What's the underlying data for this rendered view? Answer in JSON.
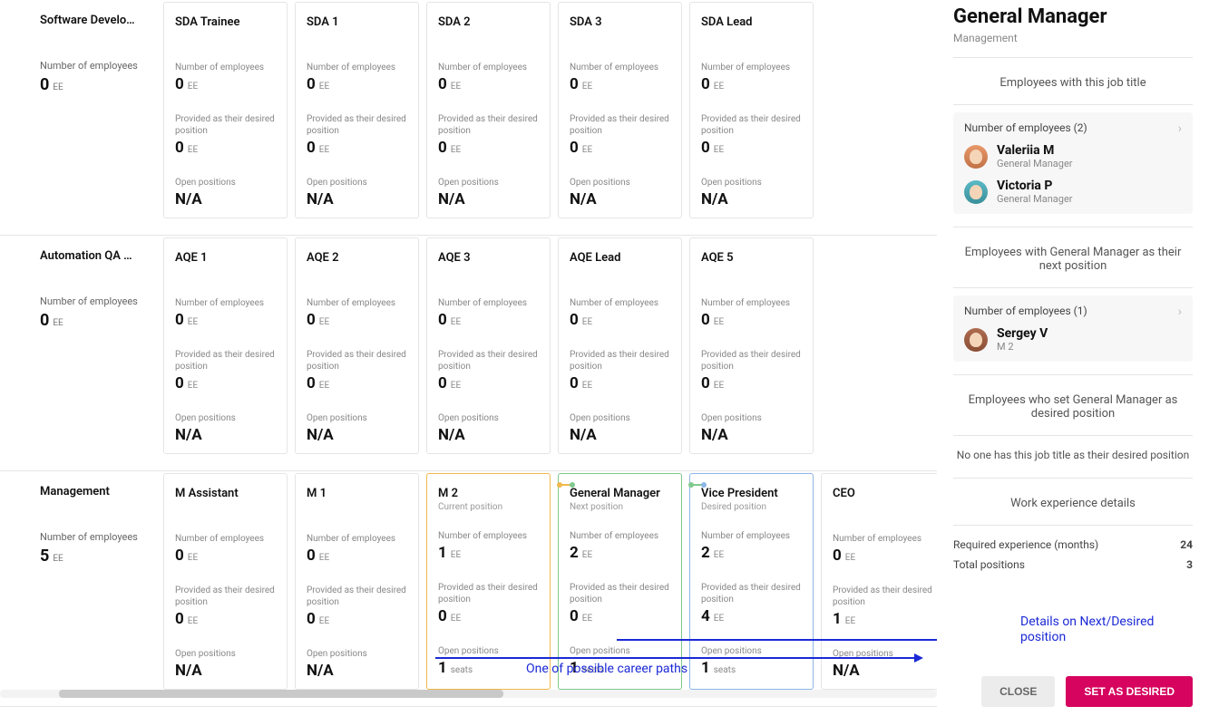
{
  "labels": {
    "num_employees": "Number of employees",
    "provided_desired": "Provided as their desired position",
    "open_positions": "Open positions",
    "ee": "EE",
    "seats": "seats",
    "na": "N/A",
    "current": "Current position",
    "next": "Next position",
    "desired": "Desired position"
  },
  "rows": [
    {
      "title": "Software Develo…",
      "total": "0",
      "cards": [
        {
          "title": "SDA Trainee",
          "emp": "0",
          "des": "0",
          "open": ""
        },
        {
          "title": "SDA 1",
          "emp": "0",
          "des": "0",
          "open": ""
        },
        {
          "title": "SDA 2",
          "emp": "0",
          "des": "0",
          "open": ""
        },
        {
          "title": "SDA 3",
          "emp": "0",
          "des": "0",
          "open": ""
        },
        {
          "title": "SDA Lead",
          "emp": "0",
          "des": "0",
          "open": ""
        }
      ]
    },
    {
      "title": "Automation QA …",
      "total": "0",
      "cards": [
        {
          "title": "AQE 1",
          "emp": "0",
          "des": "0",
          "open": ""
        },
        {
          "title": "AQE 2",
          "emp": "0",
          "des": "0",
          "open": ""
        },
        {
          "title": "AQE 3",
          "emp": "0",
          "des": "0",
          "open": ""
        },
        {
          "title": "AQE Lead",
          "emp": "0",
          "des": "0",
          "open": ""
        },
        {
          "title": "AQE 5",
          "emp": "0",
          "des": "0",
          "open": ""
        }
      ]
    },
    {
      "title": "Management",
      "total": "5",
      "cards": [
        {
          "title": "M Assistant",
          "emp": "0",
          "des": "0",
          "open": ""
        },
        {
          "title": "M 1",
          "emp": "0",
          "des": "0",
          "open": ""
        },
        {
          "title": "M 2",
          "sub": "current",
          "emp": "1",
          "des": "0",
          "open": "1",
          "open_unit": "seats",
          "state": "current"
        },
        {
          "title": "General Manager",
          "sub": "next",
          "emp": "2",
          "des": "0",
          "open": "1",
          "open_unit": "seats",
          "state": "next"
        },
        {
          "title": "Vice President",
          "sub": "desired",
          "emp": "2",
          "des": "4",
          "open": "1",
          "open_unit": "seats",
          "state": "desired"
        },
        {
          "title": "CEO",
          "emp": "0",
          "des": "1",
          "open": ""
        }
      ]
    }
  ],
  "sidebar": {
    "title": "General Manager",
    "subtitle": "Management",
    "section_with": "Employees with this job title",
    "with_count_label": "Number of employees (2)",
    "employees_with": [
      {
        "name": "Valeriia M",
        "role": "General Manager",
        "av": "a"
      },
      {
        "name": "Victoria P",
        "role": "General Manager",
        "av": "b"
      }
    ],
    "section_next": "Employees with General Manager as their next position",
    "next_count_label": "Number of employees (1)",
    "employees_next": [
      {
        "name": "Sergey V",
        "role": "M 2",
        "av": "c"
      }
    ],
    "section_desired": "Employees who set General Manager as desired position",
    "desired_empty": "No one has this job title as their desired position",
    "section_exp": "Work experience details",
    "exp_kv": [
      {
        "k": "Required experience (months)",
        "v": "24"
      },
      {
        "k": "Total positions",
        "v": "3"
      }
    ],
    "close": "CLOSE",
    "set_desired": "SET AS DESIRED"
  },
  "annotations": {
    "path": "One of possible career paths",
    "details": "Details on Next/Desired position"
  }
}
